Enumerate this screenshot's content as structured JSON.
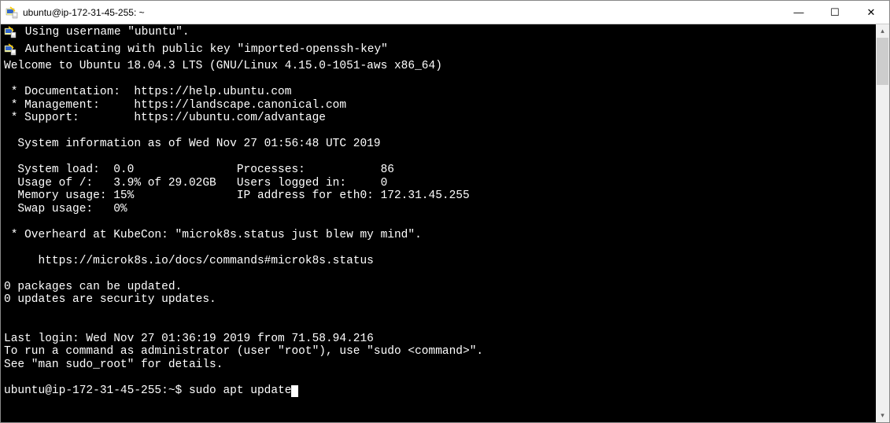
{
  "window": {
    "title": "ubuntu@ip-172-31-45-255: ~",
    "controls": {
      "minimize": "—",
      "maximize": "☐",
      "close": "✕"
    }
  },
  "terminal": {
    "lines": [
      " Using username \"ubuntu\".",
      " Authenticating with public key \"imported-openssh-key\""
    ],
    "body": "Welcome to Ubuntu 18.04.3 LTS (GNU/Linux 4.15.0-1051-aws x86_64)\n\n * Documentation:  https://help.ubuntu.com\n * Management:     https://landscape.canonical.com\n * Support:        https://ubuntu.com/advantage\n\n  System information as of Wed Nov 27 01:56:48 UTC 2019\n\n  System load:  0.0               Processes:           86\n  Usage of /:   3.9% of 29.02GB   Users logged in:     0\n  Memory usage: 15%               IP address for eth0: 172.31.45.255\n  Swap usage:   0%\n\n * Overheard at KubeCon: \"microk8s.status just blew my mind\".\n\n     https://microk8s.io/docs/commands#microk8s.status\n\n0 packages can be updated.\n0 updates are security updates.\n\n\nLast login: Wed Nov 27 01:36:19 2019 from 71.58.94.216\nTo run a command as administrator (user \"root\"), use \"sudo <command>\".\nSee \"man sudo_root\" for details.\n",
    "prompt": "ubuntu@ip-172-31-45-255:~$ ",
    "command": "sudo apt update"
  }
}
